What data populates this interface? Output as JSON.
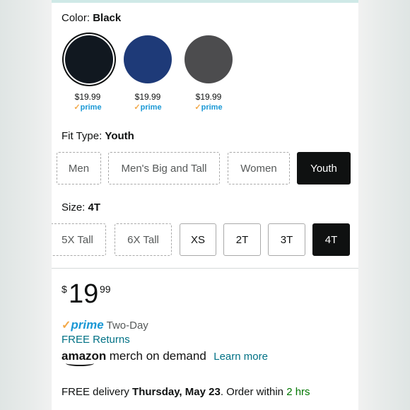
{
  "color_selector": {
    "label": "Color:",
    "selected": "Black",
    "swatches": [
      {
        "name": "Black",
        "hex": "#111820",
        "price": "$19.99",
        "badge": "prime"
      },
      {
        "name": "Navy",
        "hex": "#1e3a78",
        "price": "$19.99",
        "badge": "prime"
      },
      {
        "name": "Dark Heather",
        "hex": "#4c4c4e",
        "price": "$19.99",
        "badge": "prime"
      }
    ]
  },
  "fit_type": {
    "label": "Fit Type:",
    "selected": "Youth",
    "options": [
      "Men",
      "Men's Big and Tall",
      "Women",
      "Youth"
    ]
  },
  "size": {
    "label": "Size:",
    "selected": "4T",
    "options": [
      "5X Tall",
      "6X Tall",
      "XS",
      "2T",
      "3T",
      "4T"
    ]
  },
  "price": {
    "symbol": "$",
    "whole": "19",
    "fraction": "99"
  },
  "shipping": {
    "prime_check": "✓",
    "prime_label": "prime",
    "speed": "Two-Day",
    "returns": "FREE Returns"
  },
  "merch": {
    "brand": "amazon",
    "text": "merch on demand",
    "learn_more": "Learn more"
  },
  "delivery": {
    "prefix": "FREE delivery",
    "date": "Thursday, May 23",
    "middle": ". Order within",
    "time_left": "2 hrs"
  },
  "colors": {
    "link": "#007185",
    "prime_blue": "#1a98d5",
    "prime_check": "#f3a847",
    "green": "#007600",
    "selected_bg": "#0f1111"
  }
}
